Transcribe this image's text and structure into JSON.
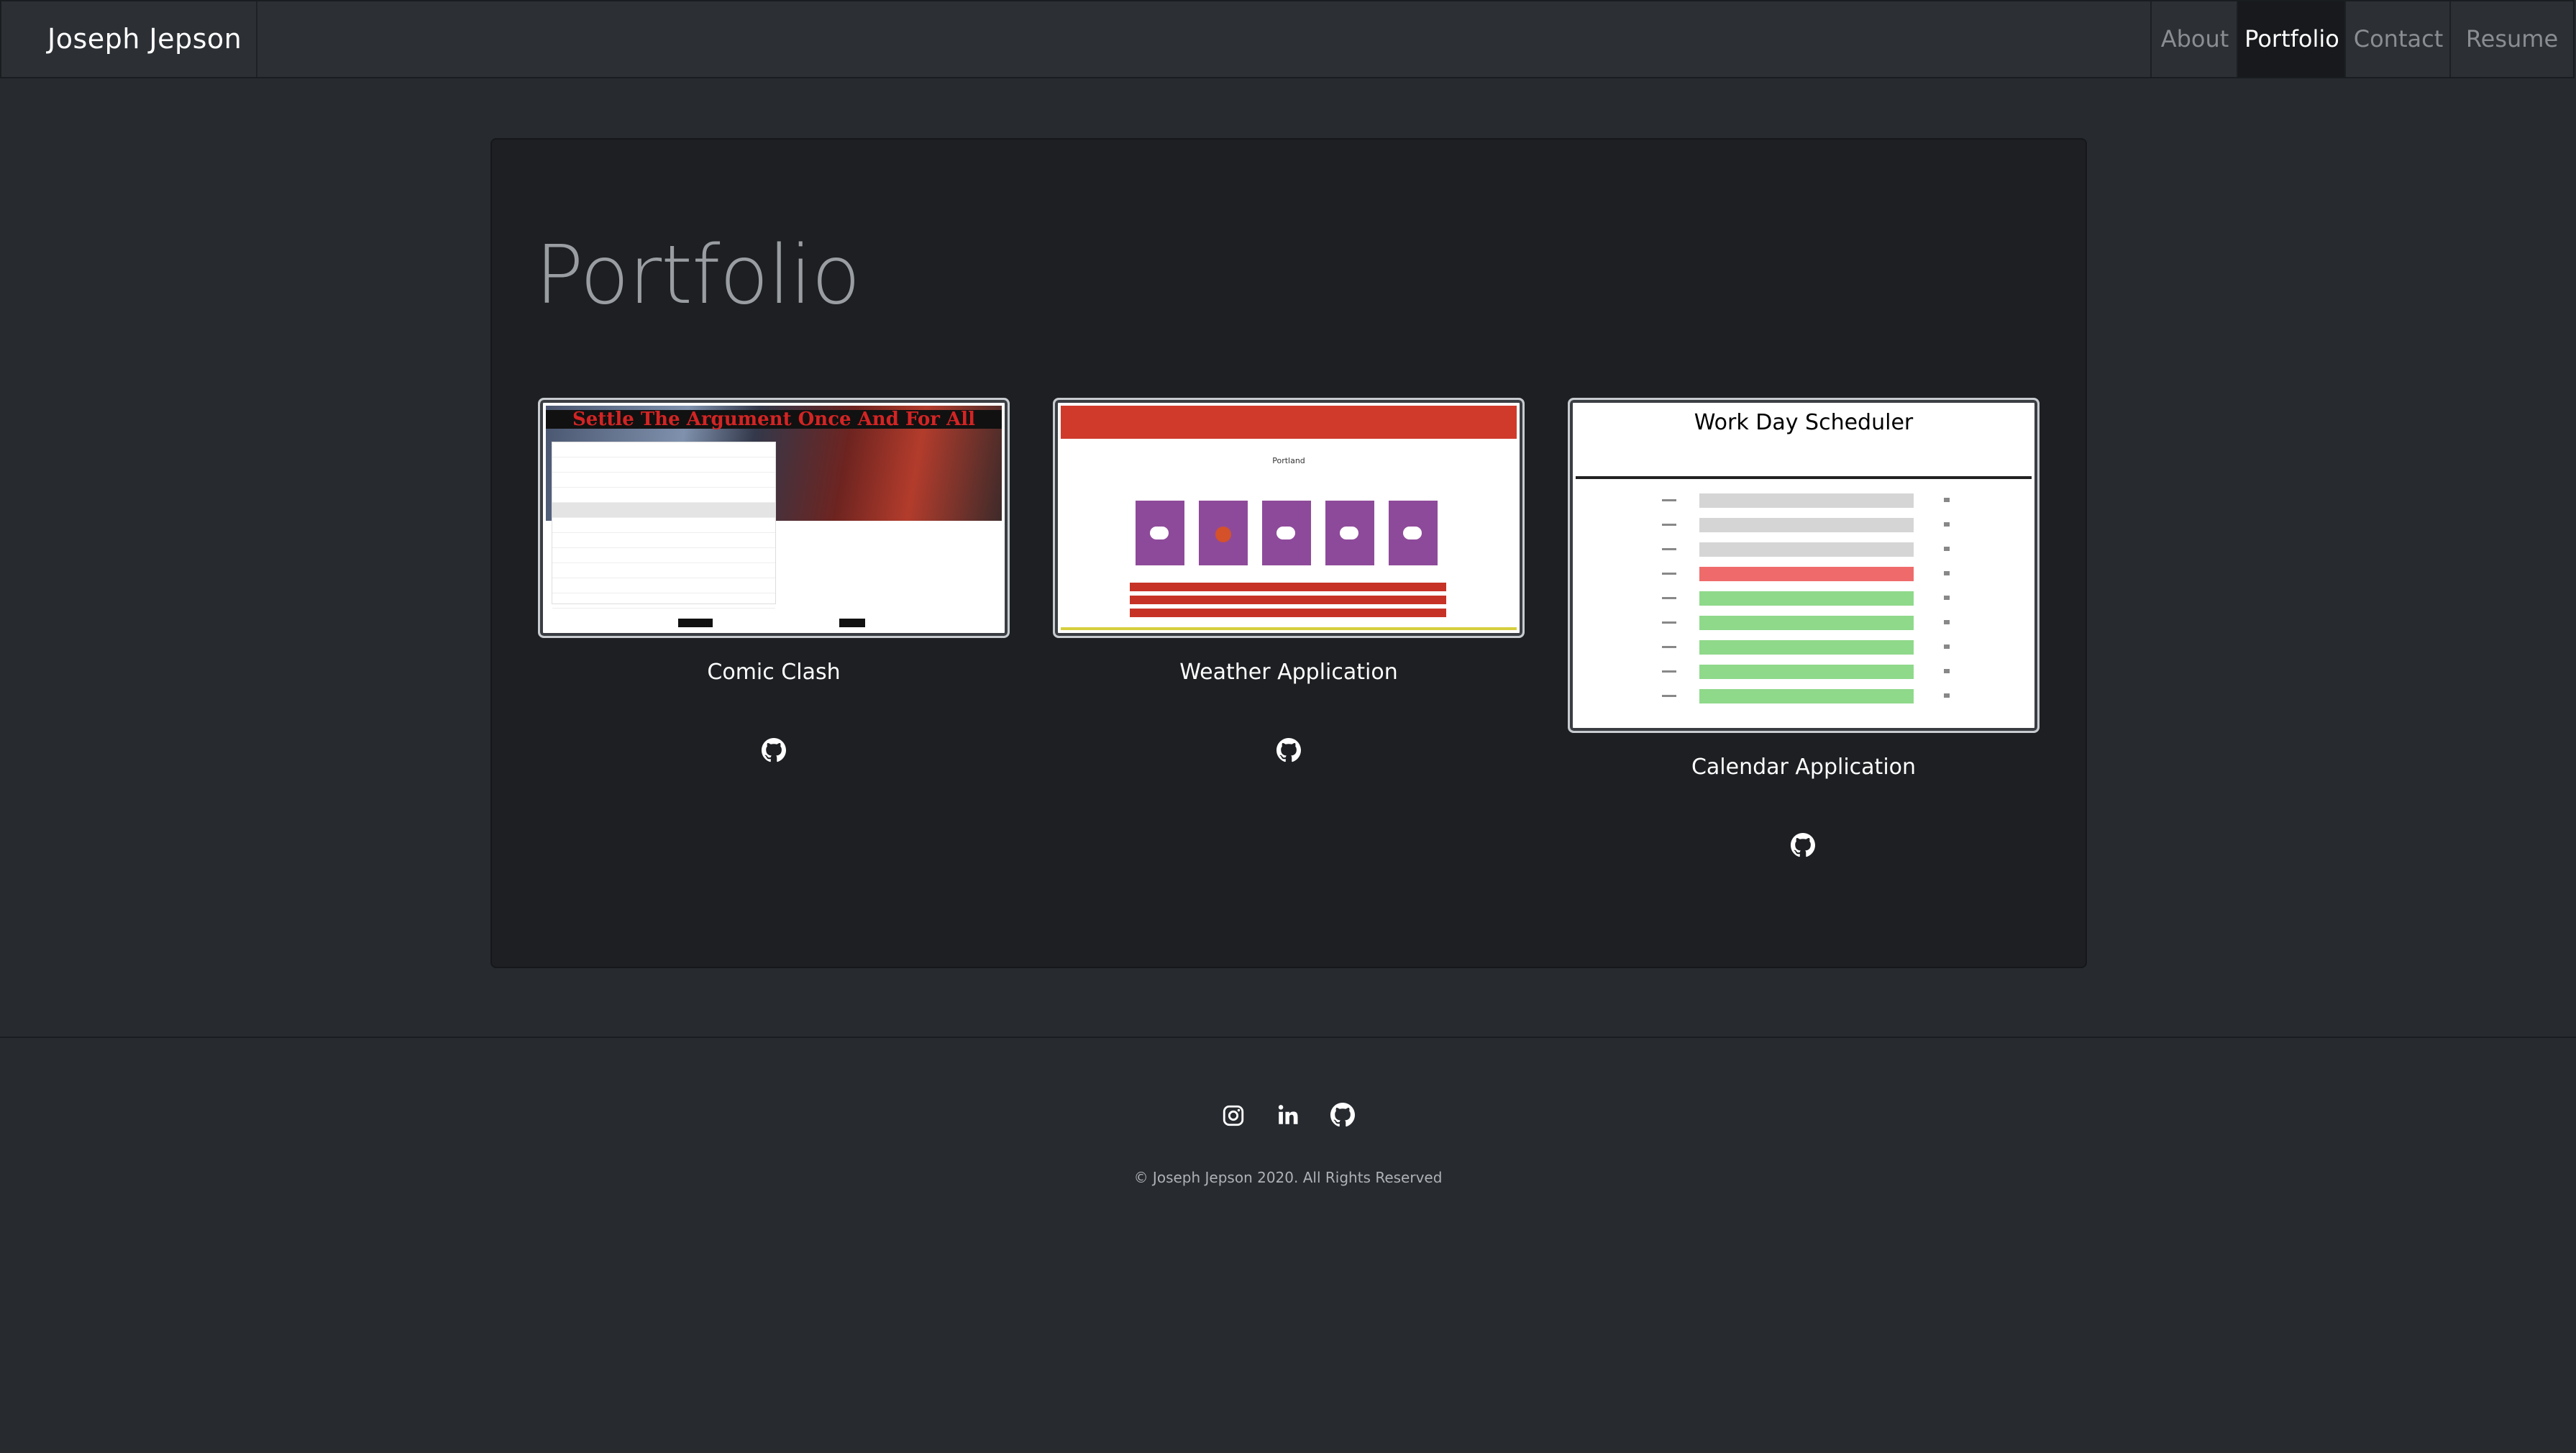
{
  "navbar": {
    "brand": "Joseph Jepson",
    "links": [
      {
        "label": "About",
        "active": false
      },
      {
        "label": "Portfolio",
        "active": true
      },
      {
        "label": "Contact",
        "active": false
      },
      {
        "label": "Resume",
        "active": false
      }
    ]
  },
  "main": {
    "title": "Portfolio",
    "projects": [
      {
        "title": "Comic Clash",
        "link_icon": "github-icon",
        "thumbnail": {
          "heading": "Settle The Argument Once And For All"
        }
      },
      {
        "title": "Weather Application",
        "link_icon": "github-icon",
        "thumbnail": {
          "city": "Portland"
        }
      },
      {
        "title": "Calendar Application",
        "link_icon": "github-icon",
        "thumbnail": {
          "heading": "Work Day Scheduler"
        }
      }
    ]
  },
  "footer": {
    "social_icons": [
      "instagram-icon",
      "linkedin-icon",
      "github-icon"
    ],
    "copyright": "© Joseph Jepson 2020. All Rights Reserved"
  },
  "colors": {
    "background": "#272b30",
    "navbar": "#2c3035",
    "panel": "#1d1f22",
    "active_nav": "#17191c"
  }
}
